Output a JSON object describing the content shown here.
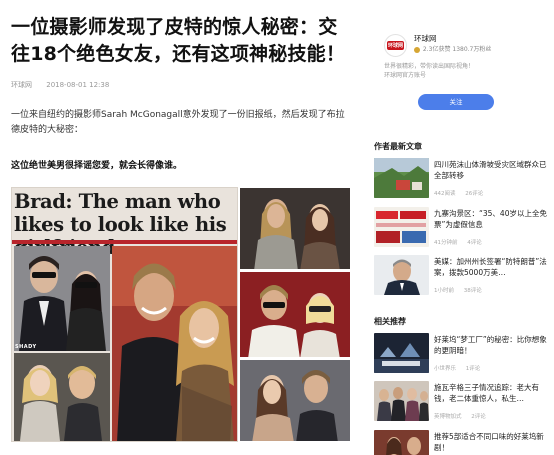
{
  "article": {
    "title": "一位摄影师发现了皮特的惊人秘密：交往18个绝色女友，还有这项神秘技能！",
    "source": "环球网",
    "date": "2018-08-01 12:38",
    "paragraph": "一位来自纽约的摄影师Sarah McGonagall意外发现了一份旧报纸，然后发现了布拉德皮特的大秘密：",
    "bold_line": "这位绝世美男很择谣您爱，就会长得像谁。",
    "collage": {
      "headline": "Brad: The man who likes to look like his girlfriend",
      "caption_tag": "SHADY"
    }
  },
  "sidebar": {
    "account": {
      "name": "环球网",
      "logo_text": "环球网",
      "stats": "2.3亿获赞  1380.7万粉丝",
      "description_1": "世界很精彩，带你读出国际视角！",
      "description_2": "环球网官方账号",
      "follow_label": "关注"
    },
    "recent_title": "作者最新文章",
    "recent": [
      {
        "title": "四川苑沫山体滑坡受灾区域群众已全部转移",
        "read": "442阅读",
        "comments": "26评论"
      },
      {
        "title": "九寨沟景区：“35、40岁以上全免票”为虚假信息",
        "read": "41分钟前",
        "comments": "4评论"
      },
      {
        "title": "美媒：加州州长签署“防特朗普”法案，拨款5000万美…",
        "read": "1小时前",
        "comments": "38评论"
      }
    ],
    "related_title": "相关推荐",
    "related": [
      {
        "title": "好莱坞“梦工厂”的秘密：比你想象的更阴暗！",
        "read": "小世界乐",
        "comments": "1评论"
      },
      {
        "title": "施瓦辛格三子情况追踪：老大有钱，老二体重惊人，私生…",
        "read": "英博物加式",
        "comments": "2评论"
      },
      {
        "title": "推荐5部适合不同口味的好莱坞新剧！",
        "read": "",
        "comments": ""
      }
    ]
  },
  "colors": {
    "follow_button": "#4c7eea",
    "accent_red": "#b8252b",
    "logo_red": "#c8161d"
  }
}
